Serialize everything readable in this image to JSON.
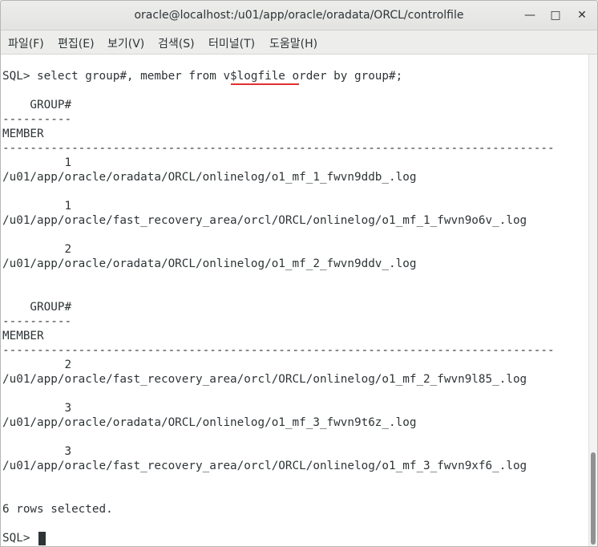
{
  "window": {
    "title": "oracle@localhost:/u01/app/oracle/oradata/ORCL/controlfile",
    "minimize_glyph": "—",
    "maximize_glyph": "□",
    "close_glyph": "✕"
  },
  "menu": [
    "파일(F)",
    "편집(E)",
    "보기(V)",
    "검색(S)",
    "터미널(T)",
    "도움말(H)"
  ],
  "terminal": {
    "lines": [
      "SQL> select group#, member from v$logfile order by group#;",
      "",
      "    GROUP#",
      "----------",
      "MEMBER",
      "--------------------------------------------------------------------------------",
      "         1",
      "/u01/app/oracle/oradata/ORCL/onlinelog/o1_mf_1_fwvn9ddb_.log",
      "",
      "         1",
      "/u01/app/oracle/fast_recovery_area/orcl/ORCL/onlinelog/o1_mf_1_fwvn9o6v_.log",
      "",
      "         2",
      "/u01/app/oracle/oradata/ORCL/onlinelog/o1_mf_2_fwvn9ddv_.log",
      "",
      "",
      "    GROUP#",
      "----------",
      "MEMBER",
      "--------------------------------------------------------------------------------",
      "         2",
      "/u01/app/oracle/fast_recovery_area/orcl/ORCL/onlinelog/o1_mf_2_fwvn9l85_.log",
      "",
      "         3",
      "/u01/app/oracle/oradata/ORCL/onlinelog/o1_mf_3_fwvn9t6z_.log",
      "",
      "         3",
      "/u01/app/oracle/fast_recovery_area/orcl/ORCL/onlinelog/o1_mf_3_fwvn9xf6_.log",
      "",
      "",
      "6 rows selected.",
      "",
      "SQL> "
    ],
    "highlight_color": "#e23030"
  }
}
